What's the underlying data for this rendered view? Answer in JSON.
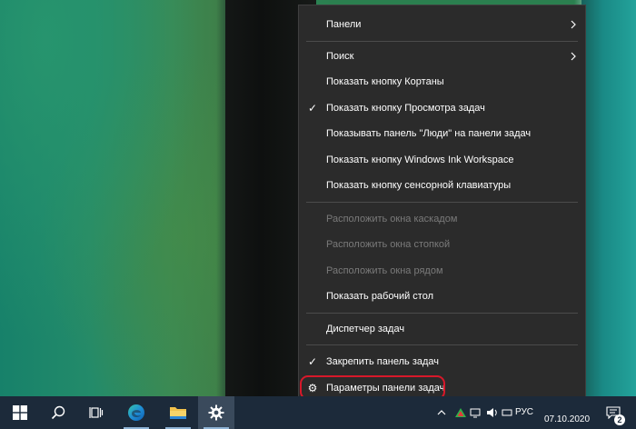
{
  "context_menu": {
    "items": [
      {
        "label": "Панели",
        "has_submenu": true
      },
      {
        "label": "Поиск",
        "has_submenu": true
      },
      {
        "label": "Показать кнопку Кортаны"
      },
      {
        "label": "Показать кнопку Просмотра задач",
        "checked": true
      },
      {
        "label": "Показывать панель \"Люди\" на панели задач"
      },
      {
        "label": "Показать кнопку Windows Ink Workspace"
      },
      {
        "label": "Показать кнопку сенсорной клавиатуры"
      },
      {
        "label": "Расположить окна каскадом",
        "disabled": true
      },
      {
        "label": "Расположить окна стопкой",
        "disabled": true
      },
      {
        "label": "Расположить окна рядом",
        "disabled": true
      },
      {
        "label": "Показать рабочий стол"
      },
      {
        "label": "Диспетчер задач"
      },
      {
        "label": "Закрепить панель задач",
        "checked": true
      },
      {
        "label": "Параметры панели задач",
        "icon": "gear-icon",
        "highlighted": true
      }
    ],
    "check_glyph": "✓",
    "gear_glyph": "⚙"
  },
  "taskbar": {
    "buttons": [
      {
        "name": "start-button",
        "icon": "windows-logo-icon"
      },
      {
        "name": "search-button",
        "icon": "search-icon"
      },
      {
        "name": "task-view-button",
        "icon": "task-view-icon"
      },
      {
        "name": "edge-button",
        "icon": "edge-browser-icon"
      },
      {
        "name": "file-explorer-button",
        "icon": "folder-icon"
      },
      {
        "name": "settings-button",
        "icon": "gear-icon"
      }
    ],
    "tray": {
      "language": "РУС",
      "time": "",
      "date": "07.10.2020",
      "notification_count": "2"
    }
  },
  "colors": {
    "menu_bg": "#2b2b2b",
    "menu_text": "#ffffff",
    "menu_disabled_text": "#7a7a7a",
    "highlight_ring": "#d8182a",
    "taskbar_bg": "#1c2a3a"
  }
}
